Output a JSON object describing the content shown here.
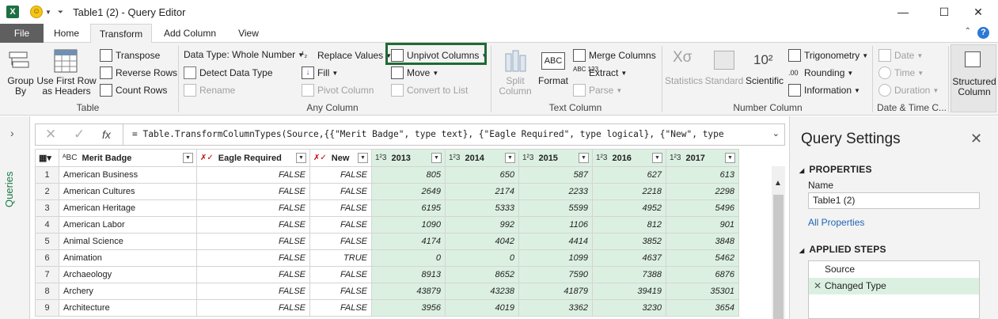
{
  "window": {
    "title": "Table1 (2) - Query Editor",
    "logo_text": "X",
    "controls": {
      "minimize": "—",
      "maximize": "☐",
      "close": "✕"
    }
  },
  "tabs": [
    {
      "label": "File"
    },
    {
      "label": "Home"
    },
    {
      "label": "Transform"
    },
    {
      "label": "Add Column"
    },
    {
      "label": "View"
    }
  ],
  "ribbon": {
    "table_group": {
      "label": "Table",
      "group_by": "Group\nBy",
      "use_first_row": "Use First Row\nas Headers",
      "transpose": "Transpose",
      "reverse_rows": "Reverse Rows",
      "count_rows": "Count Rows"
    },
    "any_column_group": {
      "label": "Any Column",
      "data_type": "Data Type: Whole Number",
      "detect_data_type": "Detect Data Type",
      "rename": "Rename",
      "replace_values": "Replace Values",
      "fill": "Fill",
      "pivot_column": "Pivot Column",
      "unpivot_columns": "Unpivot Columns",
      "move": "Move",
      "convert_to_list": "Convert to List"
    },
    "text_column_group": {
      "label": "Text Column",
      "split_column": "Split\nColumn",
      "format": "Format",
      "merge_columns": "Merge Columns",
      "extract": "Extract",
      "parse": "Parse"
    },
    "number_column_group": {
      "label": "Number Column",
      "statistics": "Statistics",
      "standard": "Standard",
      "scientific": "Scientific",
      "trigonometry": "Trigonometry",
      "rounding": "Rounding",
      "information": "Information"
    },
    "date_time_group": {
      "label": "Date & Time C...",
      "date": "Date",
      "time": "Time",
      "duration": "Duration"
    },
    "structured_column": "Structured\nColumn"
  },
  "formula_bar": {
    "text": "= Table.TransformColumnTypes(Source,{{\"Merit Badge\", type text}, {\"Eagle Required\", type logical}, {\"New\", type"
  },
  "queries_pane": {
    "label": "Queries"
  },
  "grid": {
    "columns": [
      "Merit Badge",
      "Eagle Required",
      "New",
      "2013",
      "2014",
      "2015",
      "2016",
      "2017"
    ],
    "rows": [
      {
        "n": "1",
        "badge": "American Business",
        "eagle": "FALSE",
        "new": "FALSE",
        "y2013": "805",
        "y2014": "650",
        "y2015": "587",
        "y2016": "627",
        "y2017": "613"
      },
      {
        "n": "2",
        "badge": "American Cultures",
        "eagle": "FALSE",
        "new": "FALSE",
        "y2013": "2649",
        "y2014": "2174",
        "y2015": "2233",
        "y2016": "2218",
        "y2017": "2298"
      },
      {
        "n": "3",
        "badge": "American Heritage",
        "eagle": "FALSE",
        "new": "FALSE",
        "y2013": "6195",
        "y2014": "5333",
        "y2015": "5599",
        "y2016": "4952",
        "y2017": "5496"
      },
      {
        "n": "4",
        "badge": "American Labor",
        "eagle": "FALSE",
        "new": "FALSE",
        "y2013": "1090",
        "y2014": "992",
        "y2015": "1106",
        "y2016": "812",
        "y2017": "901"
      },
      {
        "n": "5",
        "badge": "Animal Science",
        "eagle": "FALSE",
        "new": "FALSE",
        "y2013": "4174",
        "y2014": "4042",
        "y2015": "4414",
        "y2016": "3852",
        "y2017": "3848"
      },
      {
        "n": "6",
        "badge": "Animation",
        "eagle": "FALSE",
        "new": "TRUE",
        "y2013": "0",
        "y2014": "0",
        "y2015": "1099",
        "y2016": "4637",
        "y2017": "5462"
      },
      {
        "n": "7",
        "badge": "Archaeology",
        "eagle": "FALSE",
        "new": "FALSE",
        "y2013": "8913",
        "y2014": "8652",
        "y2015": "7590",
        "y2016": "7388",
        "y2017": "6876"
      },
      {
        "n": "8",
        "badge": "Archery",
        "eagle": "FALSE",
        "new": "FALSE",
        "y2013": "43879",
        "y2014": "43238",
        "y2015": "41879",
        "y2016": "39419",
        "y2017": "35301"
      },
      {
        "n": "9",
        "badge": "Architecture",
        "eagle": "FALSE",
        "new": "FALSE",
        "y2013": "3956",
        "y2014": "4019",
        "y2015": "3362",
        "y2016": "3230",
        "y2017": "3654"
      }
    ]
  },
  "query_settings": {
    "title": "Query Settings",
    "properties_label": "PROPERTIES",
    "name_label": "Name",
    "name_value": "Table1 (2)",
    "all_properties": "All Properties",
    "applied_steps_label": "APPLIED STEPS",
    "steps": [
      "Source",
      "Changed Type"
    ]
  },
  "colors": {
    "accent_green": "#1e6b34",
    "numeric_column_fill": "#dcf0e2",
    "file_tab": "#5f5f5f",
    "link": "#1f63b5"
  }
}
